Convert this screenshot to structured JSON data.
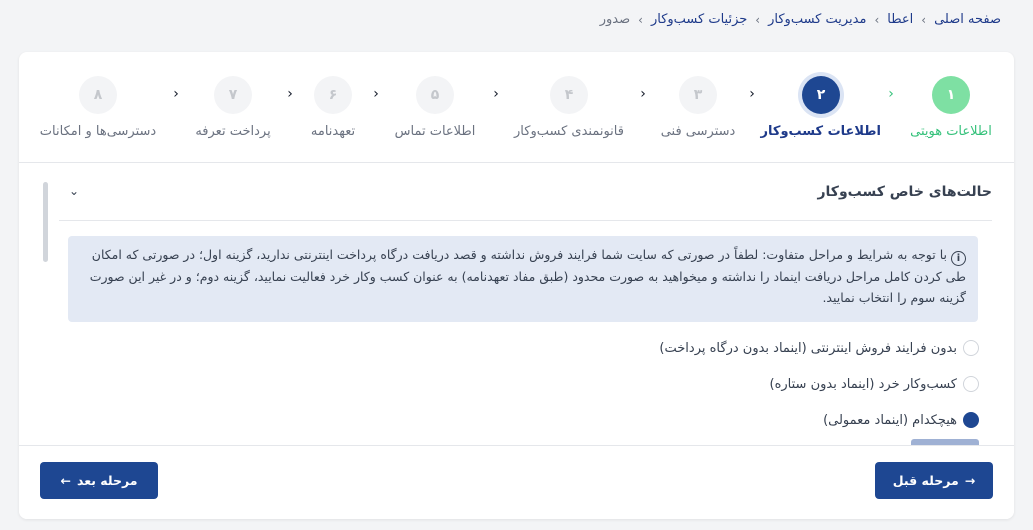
{
  "breadcrumb": {
    "items": [
      "صفحه اصلی",
      "اعطا",
      "مدیریت کسب‌وکار",
      "جزئیات کسب‌وکار"
    ],
    "current": "صدور"
  },
  "steps": [
    {
      "number": "۱",
      "label": "اطلاعات هویتی",
      "state": "done"
    },
    {
      "number": "۲",
      "label": "اطلاعات کسب‌وکار",
      "state": "active"
    },
    {
      "number": "۳",
      "label": "دسترسی فنی",
      "state": "pending"
    },
    {
      "number": "۴",
      "label": "قانونمندی کسب‌وکار",
      "state": "pending"
    },
    {
      "number": "۵",
      "label": "اطلاعات تماس",
      "state": "pending"
    },
    {
      "number": "۶",
      "label": "تعهدنامه",
      "state": "pending"
    },
    {
      "number": "۷",
      "label": "پرداخت تعرفه",
      "state": "pending"
    },
    {
      "number": "۸",
      "label": "دسترسی‌ها و امکانات",
      "state": "pending"
    }
  ],
  "section": {
    "title": "حالت‌های خاص کسب‌وکار",
    "info_text": "با توجه به شرایط و مراحل متفاوت: لطفاً در صورتی که سایت شما فرایند فروش نداشته و قصد دریافت درگاه پرداخت اینترنتی ندارید، گزینه اول؛ در صورتی که امکان طی کردن کامل مراحل دریافت اینماد را نداشته و میخواهید به صورت محدود (طبق مفاد تعهدنامه) به عنوان کسب وکار خرد فعالیت نمایید، گزینه دوم؛ و در غیر این صورت گزینه سوم را انتخاب نمایید.",
    "options": [
      {
        "label": "بدون فرایند فروش اینترنتی (اینماد بدون درگاه پرداخت)",
        "checked": false
      },
      {
        "label": "کسب‌وکار خرد (اینماد بدون ستاره)",
        "checked": false
      },
      {
        "label": "هیچکدام (اینماد معمولی)",
        "checked": true
      }
    ]
  },
  "footer": {
    "prev_label": "مرحله قبل",
    "next_label": "مرحله بعد"
  },
  "colors": {
    "primary": "#1e4792",
    "success": "#34c17a",
    "info_bg": "#e3e9f4"
  }
}
